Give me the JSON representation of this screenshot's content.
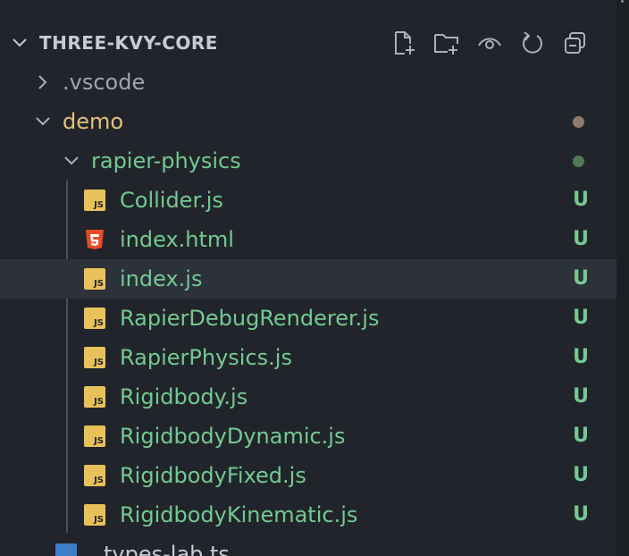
{
  "explorer": {
    "title": "THREE-KVY-CORE",
    "actions": [
      {
        "name": "new-file-icon"
      },
      {
        "name": "new-folder-icon"
      },
      {
        "name": "eye-icon"
      },
      {
        "name": "refresh-icon"
      },
      {
        "name": "collapse-all-icon"
      }
    ]
  },
  "tree": {
    "vscode": {
      "label": ".vscode",
      "expanded": false
    },
    "demo": {
      "label": "demo",
      "expanded": true,
      "dot_color": "#8c7b66"
    },
    "rapier": {
      "label": "rapier-physics",
      "expanded": true,
      "dot_color": "#4e7a55"
    },
    "files": [
      {
        "label": "Collider.js",
        "icon": "js-file-icon",
        "status": "U"
      },
      {
        "label": "index.html",
        "icon": "html5-file-icon",
        "status": "U"
      },
      {
        "label": "index.js",
        "icon": "js-file-icon",
        "status": "U",
        "selected": true
      },
      {
        "label": "RapierDebugRenderer.js",
        "icon": "js-file-icon",
        "status": "U"
      },
      {
        "label": "RapierPhysics.js",
        "icon": "js-file-icon",
        "status": "U"
      },
      {
        "label": "Rigidbody.js",
        "icon": "js-file-icon",
        "status": "U"
      },
      {
        "label": "RigidbodyDynamic.js",
        "icon": "js-file-icon",
        "status": "U"
      },
      {
        "label": "RigidbodyFixed.js",
        "icon": "js-file-icon",
        "status": "U"
      },
      {
        "label": "RigidbodyKinematic.js",
        "icon": "js-file-icon",
        "status": "U"
      }
    ],
    "partial": {
      "label": "types-lab.ts",
      "icon": "ts-file-icon"
    }
  },
  "colors": {
    "folder_text": "#e5c07b",
    "untracked_text": "#73c991",
    "muted_text": "#9da5b4",
    "js_badge": "JS"
  }
}
